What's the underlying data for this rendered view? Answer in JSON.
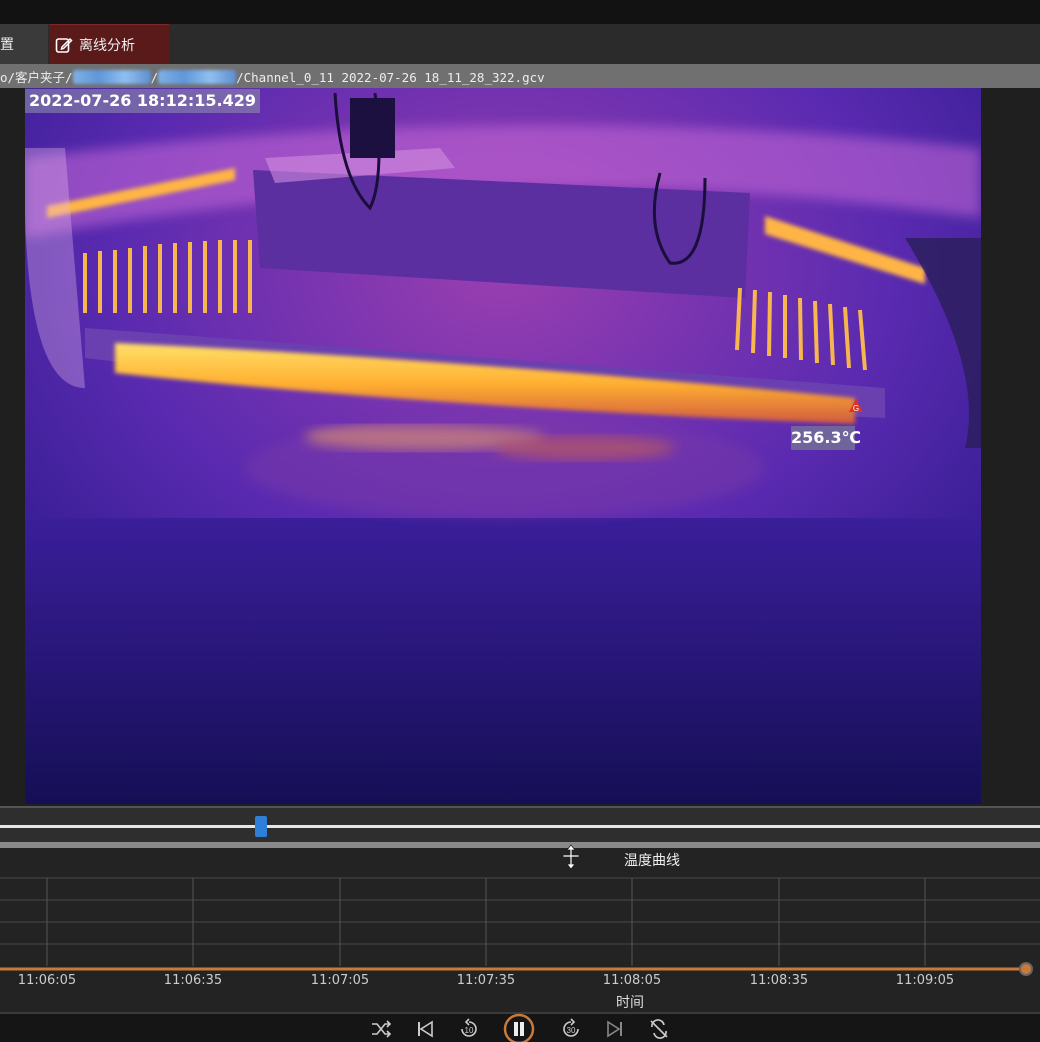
{
  "tabs": [
    {
      "label": "置"
    },
    {
      "label": "离线分析"
    }
  ],
  "path": {
    "prefix": "o/客户夹子/",
    "sep": "/",
    "file": "/Channel_0_11 2022-07-26 18_11_28_322.gcv"
  },
  "viewer": {
    "timestamp": "2022-07-26 18:12:15.429",
    "temperature": "256.3℃",
    "marker_label": "G"
  },
  "timeline": {
    "position_fraction": 0.25
  },
  "chart": {
    "title": "温度曲线",
    "xlabel": "时间",
    "ticks": [
      "11:06:05",
      "11:06:35",
      "11:07:05",
      "11:07:35",
      "11:08:05",
      "11:08:35",
      "11:09:05"
    ],
    "series_color": "#c87a3a"
  },
  "controls": [
    "shuffle-icon",
    "previous-icon",
    "rewind-10-icon",
    "pause-icon",
    "forward-30-icon",
    "next-icon",
    "loop-icon"
  ],
  "colors": {
    "accent": "#2f7fd8",
    "tab_active": "#5a1a1a",
    "series": "#c87a3a"
  }
}
